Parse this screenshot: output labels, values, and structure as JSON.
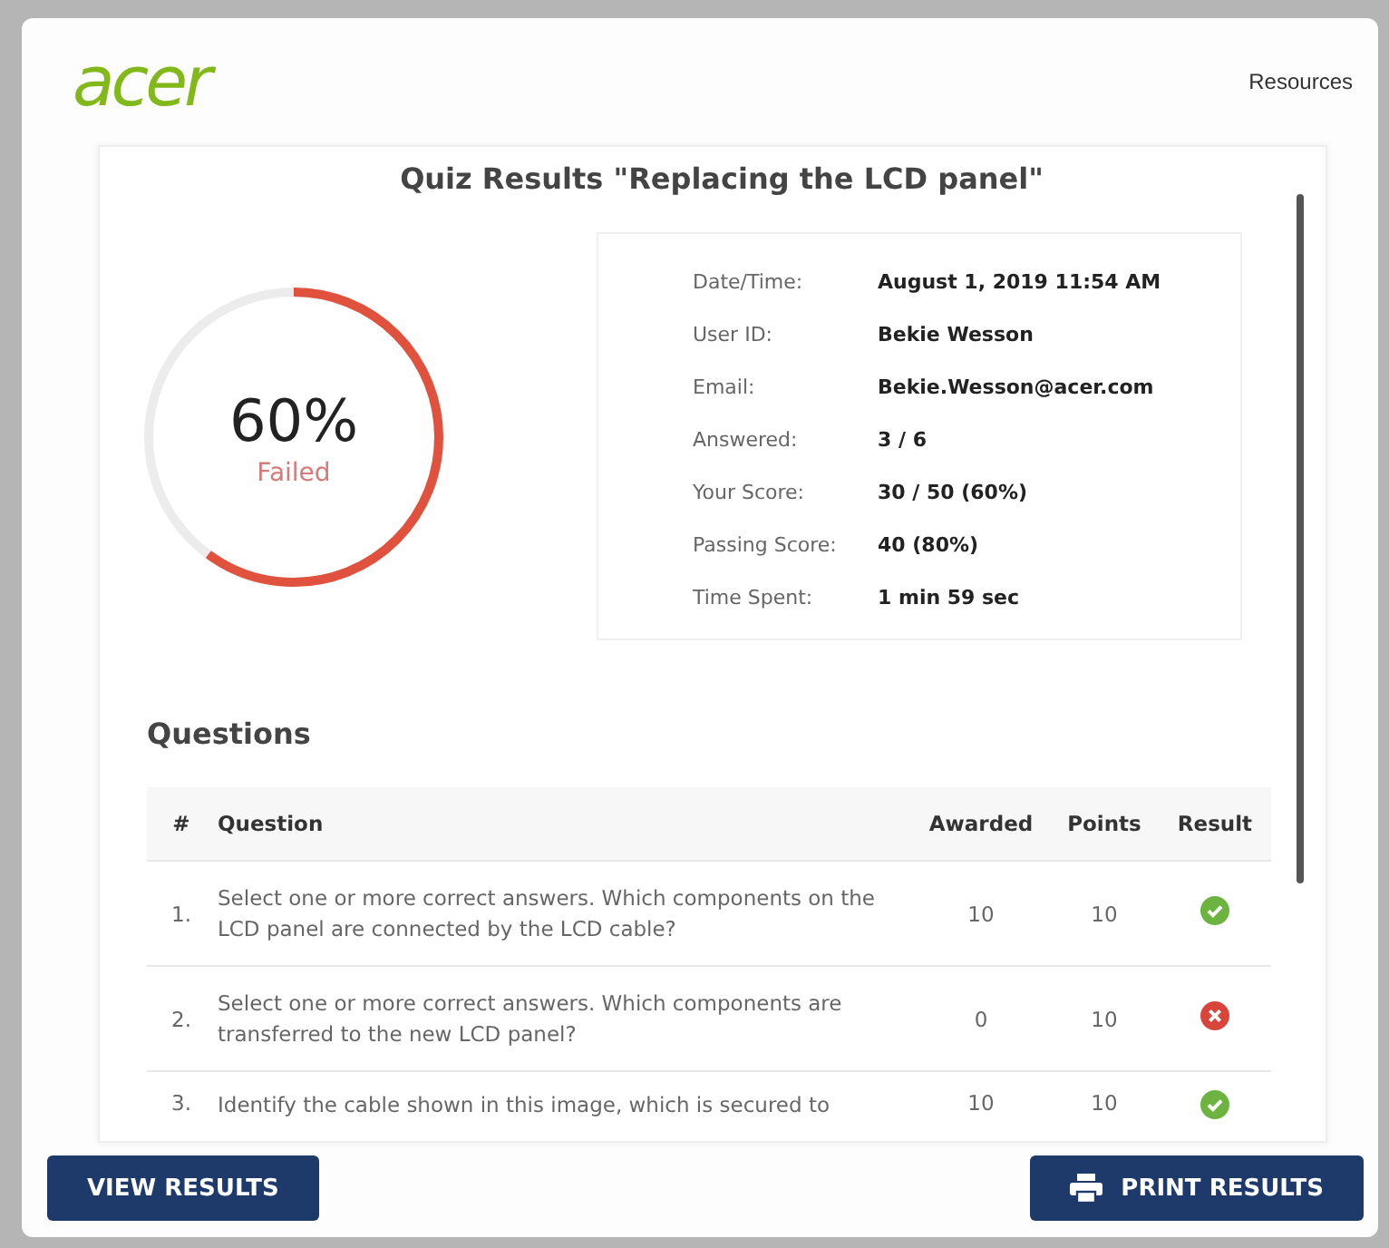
{
  "header": {
    "logo": "acer",
    "link": "Resources"
  },
  "title": "Quiz Results \"Replacing the LCD panel\"",
  "score": {
    "percent": "60%",
    "status": "Failed",
    "level": 0.6
  },
  "details": [
    {
      "label": "Date/Time:",
      "value": "August 1, 2019 11:54 AM"
    },
    {
      "label": "User ID:",
      "value": "Bekie Wesson"
    },
    {
      "label": "Email:",
      "value": "Bekie.Wesson@acer.com"
    },
    {
      "label": "Answered:",
      "value": "3 / 6"
    },
    {
      "label": "Your Score:",
      "value": "30 / 50 (60%)"
    },
    {
      "label": "Passing Score:",
      "value": "40 (80%)"
    },
    {
      "label": "Time Spent:",
      "value": "1 min 59 sec"
    }
  ],
  "questions_heading": "Questions",
  "table": {
    "columns": [
      "#",
      "Question",
      "Awarded",
      "Points",
      "Result"
    ],
    "rows": [
      {
        "number": "1.",
        "question": "Select one or more correct answers.  Which components on the LCD panel are connected by the LCD cable?",
        "awarded": "10",
        "points": "10",
        "correct": true
      },
      {
        "number": "2.",
        "question": "Select one or more correct answers.  Which components are transferred to the new LCD panel?",
        "awarded": "0",
        "points": "10",
        "correct": false
      },
      {
        "number": "3.",
        "question": "Identify the cable shown in this image, which is secured to",
        "awarded": "10",
        "points": "10",
        "correct": true
      }
    ]
  },
  "buttons": [
    {
      "label": "VIEW RESULTS",
      "kind": "plain"
    },
    {
      "label": "PRINT RESULTS",
      "kind": "print"
    }
  ]
}
